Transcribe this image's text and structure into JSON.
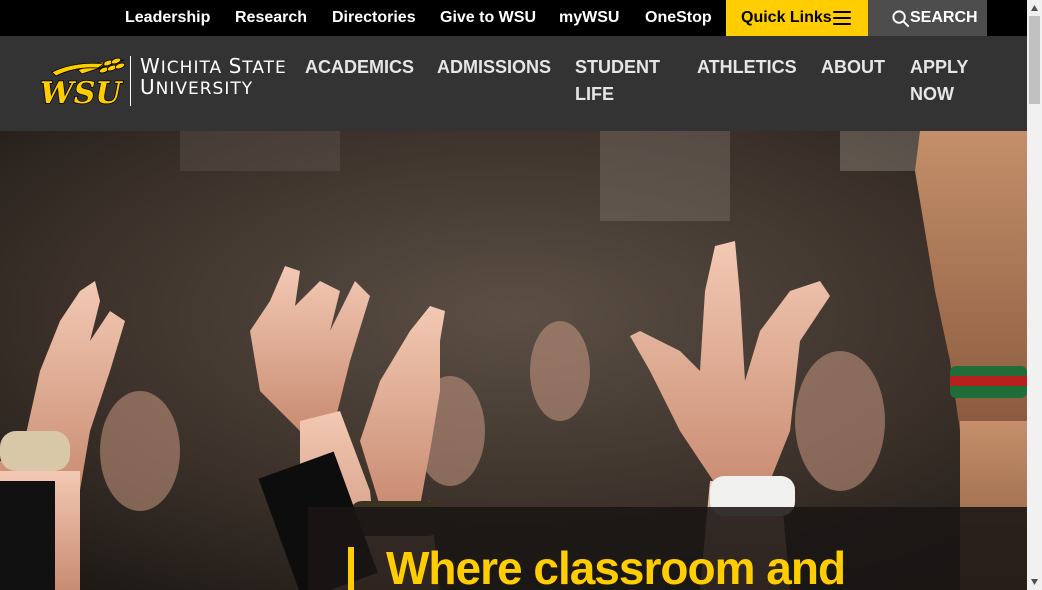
{
  "utility_nav": {
    "links": [
      "Leadership",
      "Research",
      "Directories",
      "Give to WSU",
      "myWSU",
      "OneStop"
    ],
    "quick_links_label": "Quick Links",
    "search_label": "SEARCH"
  },
  "logo": {
    "monogram": "WSU",
    "line1_initial1": "W",
    "line1_rest1": "ICHITA ",
    "line1_initial2": "S",
    "line1_rest2": "TATE",
    "line2_initial": "U",
    "line2_rest": "NIVERSITY"
  },
  "main_nav": {
    "items": [
      "ACADEMICS",
      "ADMISSIONS",
      "STUDENT LIFE",
      "ATHLETICS",
      "ABOUT",
      "APPLY NOW"
    ]
  },
  "hero": {
    "heading": "Where classroom and"
  },
  "colors": {
    "brand_yellow": "#ffcd00",
    "utility_bar": "#000000",
    "header": "#333333",
    "search_bg": "#4d4d4d"
  },
  "icons": [
    "hamburger-icon",
    "search-icon",
    "wsu-shocker-logo",
    "scroll-up-arrow-icon",
    "scroll-down-arrow-icon"
  ]
}
